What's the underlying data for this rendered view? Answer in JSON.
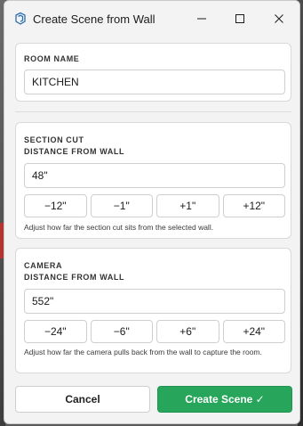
{
  "window": {
    "title": "Create Scene from Wall",
    "app_icon": "sketchup-icon",
    "controls": {
      "minimize": "minimize-icon",
      "maximize": "maximize-icon",
      "close": "close-icon"
    }
  },
  "room": {
    "label": "ROOM NAME",
    "value": "KITCHEN"
  },
  "section_cut": {
    "label_line1": "SECTION CUT",
    "label_line2": "DISTANCE FROM WALL",
    "value": "48\"",
    "steps": [
      "−12\"",
      "−1\"",
      "+1\"",
      "+12\""
    ],
    "help": "Adjust how far the section cut sits from the selected wall."
  },
  "camera": {
    "label_line1": "CAMERA",
    "label_line2": "DISTANCE FROM WALL",
    "value": "552\"",
    "steps": [
      "−24\"",
      "−6\"",
      "+6\"",
      "+24\""
    ],
    "help": "Adjust how far the camera pulls back from the wall to capture the room."
  },
  "footer": {
    "cancel_label": "Cancel",
    "create_label": "Create Scene ✓",
    "create_color": "#27a55a"
  }
}
